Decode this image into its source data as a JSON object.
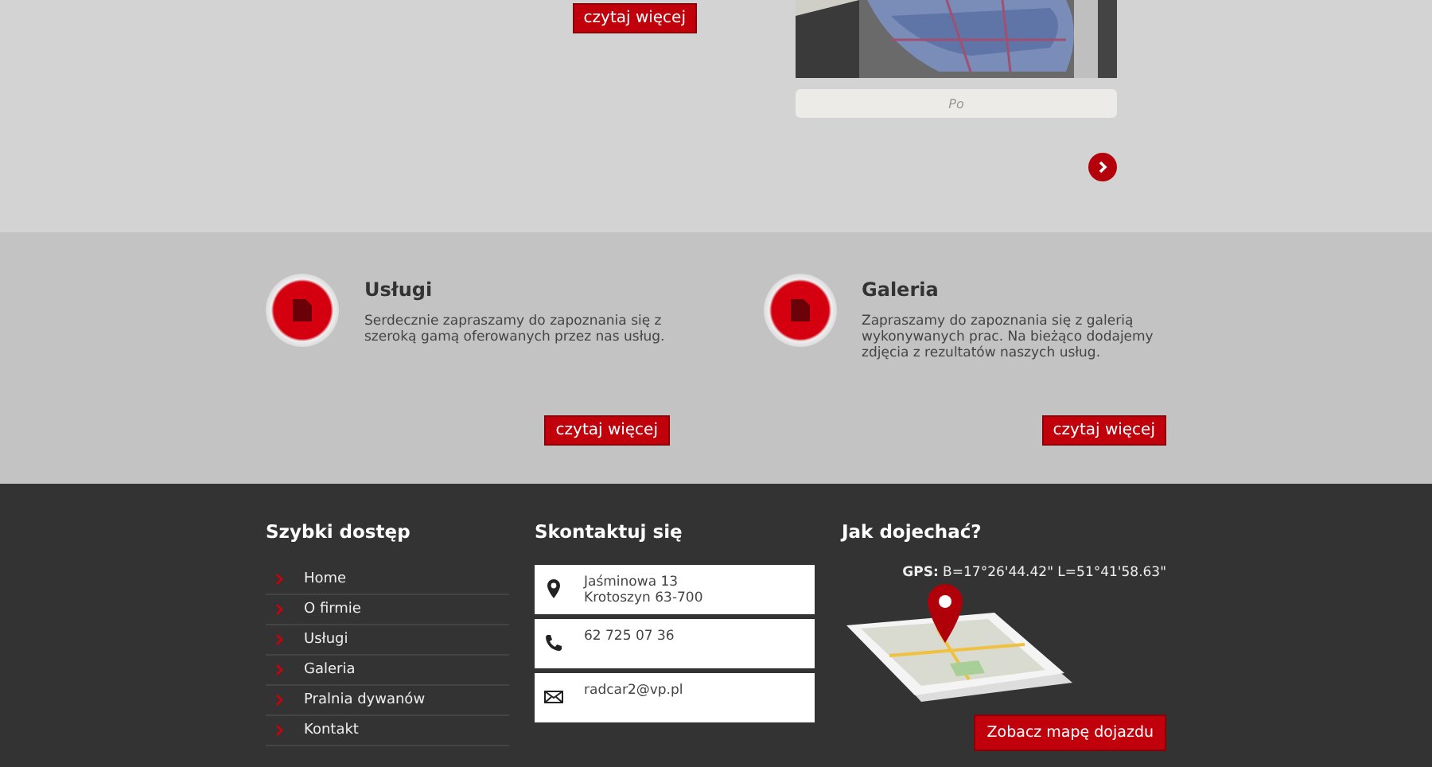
{
  "top": {
    "read_more": "czytaj więcej",
    "caption": "Po"
  },
  "features": [
    {
      "title": "Usługi",
      "text": "Serdecznie zapraszamy do zapoznania się z szeroką gamą oferowanych przez nas usług.",
      "button": "czytaj więcej"
    },
    {
      "title": "Galeria",
      "text": "Zapraszamy do zapoznania się z galerią wykonywanych prac. Na bieżąco dodajemy zdjęcia z rezultatów naszych usług.",
      "button": "czytaj więcej"
    }
  ],
  "footer": {
    "quick_links": {
      "title": "Szybki dostęp",
      "items": [
        "Home",
        "O firmie",
        "Usługi",
        "Galeria",
        "Pralnia dywanów",
        "Kontakt"
      ]
    },
    "contact": {
      "title": "Skontaktuj się",
      "items": [
        {
          "kind": "address",
          "lines": [
            "Jaśminowa 13",
            "Krotoszyn 63-700"
          ]
        },
        {
          "kind": "phone",
          "lines": [
            "62 725 07 36"
          ]
        },
        {
          "kind": "email",
          "lines": [
            "radcar2@vp.pl"
          ]
        }
      ]
    },
    "directions": {
      "title": "Jak dojechać?",
      "gps": "**GPS:** B=17°26'44.42\" L=51°41'58.63\"",
      "button": "Zobacz mapę dojazdu"
    }
  }
}
